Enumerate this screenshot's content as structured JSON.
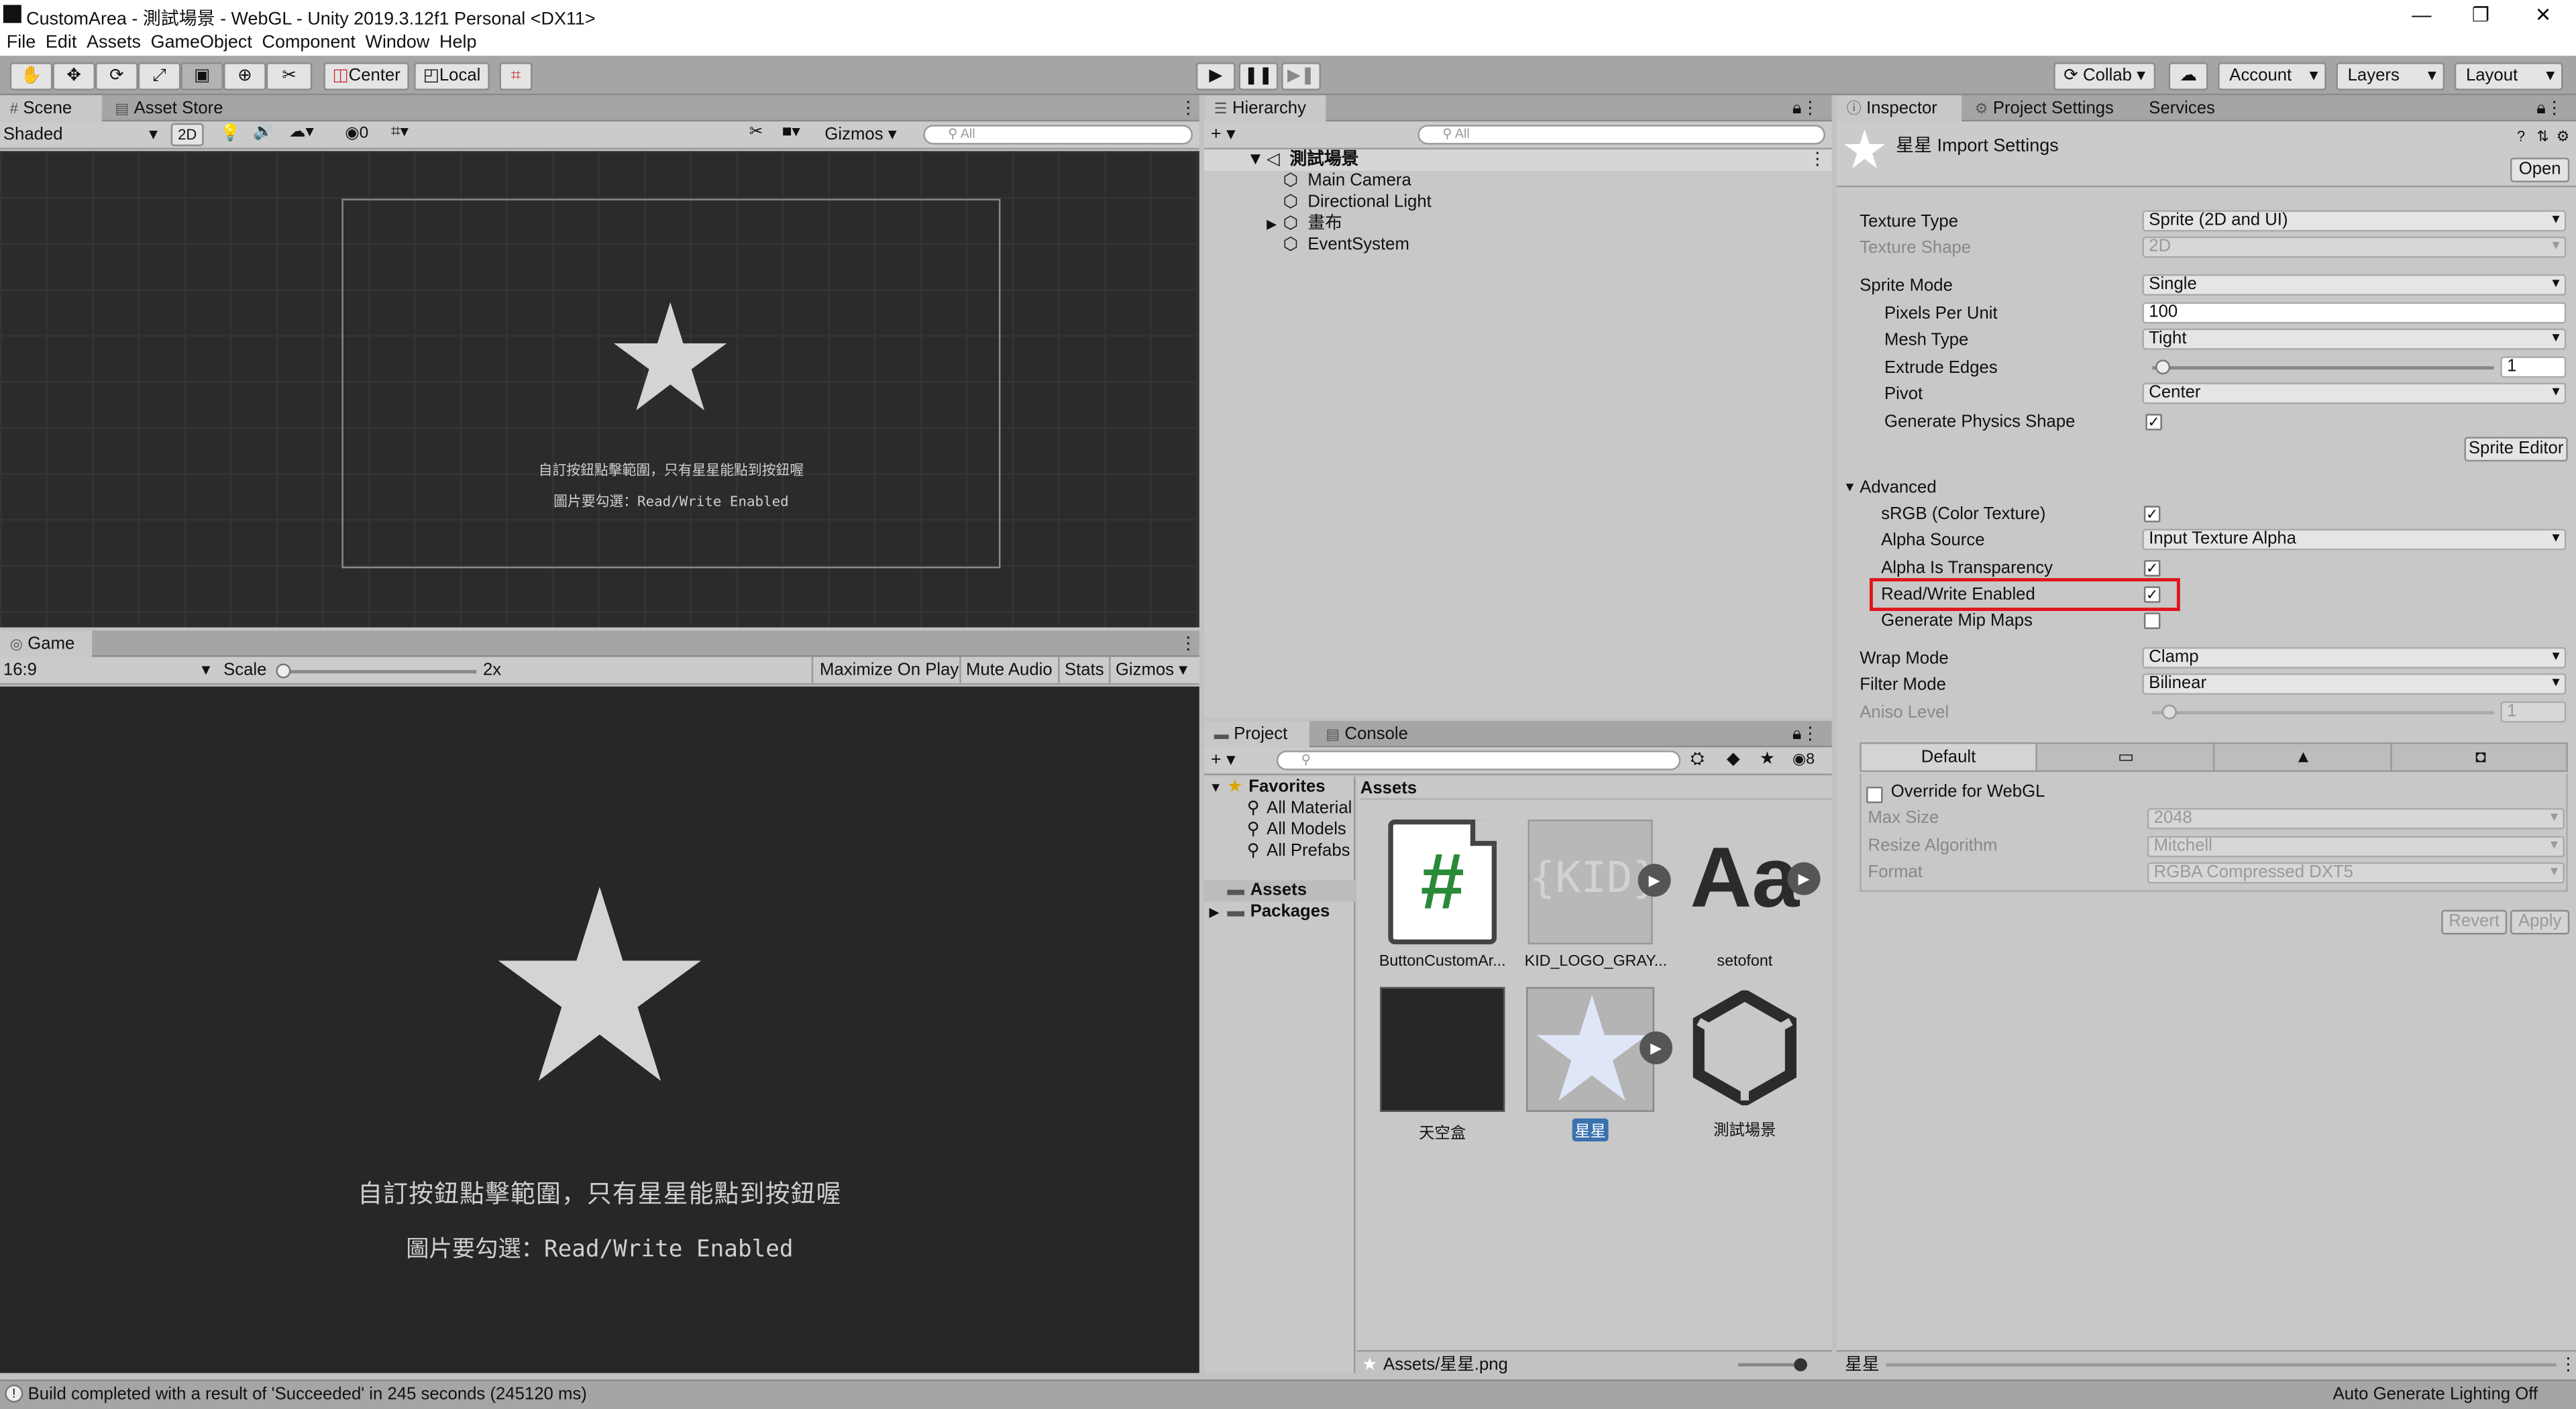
{
  "window": {
    "title": "CustomArea - 測試場景 - WebGL - Unity 2019.3.12f1 Personal <DX11>",
    "minimize": "—",
    "maximize": "❐",
    "close": "✕"
  },
  "menu": [
    "File",
    "Edit",
    "Assets",
    "GameObject",
    "Component",
    "Window",
    "Help"
  ],
  "toolbar": {
    "pivot_label": "Center",
    "space_label": "Local",
    "collab_label": "Collab",
    "account_label": "Account",
    "layers_label": "Layers",
    "layout_label": "Layout"
  },
  "scene": {
    "tabs": [
      "Scene",
      "Asset Store"
    ],
    "shading_mode": "Shaded",
    "mode_2d": "2D",
    "hidden_count": "0",
    "gizmos_label": "Gizmos",
    "search_placeholder": "All",
    "text_line1": "自訂按鈕點擊範圍，只有星星能點到按鈕喔",
    "text_line2": "圖片要勾選：Read/Write Enabled"
  },
  "game": {
    "tab": "Game",
    "aspect": "16:9",
    "scale_label": "Scale",
    "scale_value": "2x",
    "maximize_label": "Maximize On Play",
    "mute_label": "Mute Audio",
    "stats_label": "Stats",
    "gizmos_label": "Gizmos",
    "text_line1": "自訂按鈕點擊範圍，只有星星能點到按鈕喔",
    "text_line2": "圖片要勾選：Read/Write Enabled"
  },
  "hierarchy": {
    "tab": "Hierarchy",
    "search_placeholder": "All",
    "scene_name": "測試場景",
    "items": [
      "Main Camera",
      "Directional Light",
      "畫布",
      "EventSystem"
    ]
  },
  "project": {
    "tabs": [
      "Project",
      "Console"
    ],
    "hidden_count": "8",
    "favorites_label": "Favorites",
    "favorites": [
      "All Material",
      "All Models",
      "All Prefabs"
    ],
    "folders": [
      "Assets",
      "Packages"
    ],
    "breadcrumb": "Assets",
    "assets": [
      "ButtonCustomAr...",
      "KID_LOGO_GRAY...",
      "setofont",
      "天空盒",
      "星星",
      "測試場景"
    ],
    "kid_text": "{KID}",
    "font_preview": "Aa",
    "hash_glyph": "#",
    "footer_path": "Assets/星星.png"
  },
  "inspector": {
    "tabs": [
      "Inspector",
      "Project Settings",
      "Services"
    ],
    "header_title": "星星 Import Settings",
    "open_label": "Open",
    "texture_type_label": "Texture Type",
    "texture_type": "Sprite (2D and UI)",
    "texture_shape_label": "Texture Shape",
    "texture_shape": "2D",
    "sprite_mode_label": "Sprite Mode",
    "sprite_mode": "Single",
    "ppu_label": "Pixels Per Unit",
    "ppu": "100",
    "mesh_type_label": "Mesh Type",
    "mesh_type": "Tight",
    "extrude_label": "Extrude Edges",
    "extrude": "1",
    "pivot_label": "Pivot",
    "pivot": "Center",
    "gen_physics_label": "Generate Physics Shape",
    "sprite_editor_label": "Sprite Editor",
    "advanced_label": "Advanced",
    "srgb_label": "sRGB (Color Texture)",
    "alpha_source_label": "Alpha Source",
    "alpha_source": "Input Texture Alpha",
    "alpha_transp_label": "Alpha Is Transparency",
    "rw_label": "Read/Write Enabled",
    "mipmaps_label": "Generate Mip Maps",
    "wrap_label": "Wrap Mode",
    "wrap": "Clamp",
    "filter_label": "Filter Mode",
    "filter": "Bilinear",
    "aniso_label": "Aniso Level",
    "aniso": "1",
    "platform_default": "Default",
    "override_label": "Override for WebGL",
    "max_size_label": "Max Size",
    "max_size": "2048",
    "resize_label": "Resize Algorithm",
    "resize": "Mitchell",
    "format_label": "Format",
    "format": "RGBA Compressed DXT5",
    "revert_label": "Revert",
    "apply_label": "Apply",
    "footer_name": "星星",
    "highlight_color": "#e0141c"
  },
  "status": {
    "message": "Build completed with a result of 'Succeeded' in 245 seconds (245120 ms)",
    "lighting": "Auto Generate Lighting Off"
  }
}
